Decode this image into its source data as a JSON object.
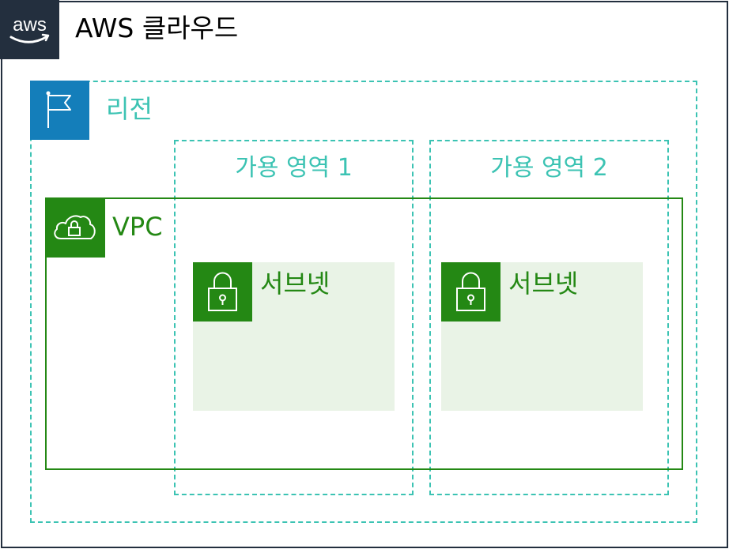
{
  "cloud": {
    "title": "AWS 클라우드",
    "logo_text": "aws"
  },
  "region": {
    "label": "리전",
    "icon": "flag-icon"
  },
  "availability_zones": [
    {
      "label": "가용 영역 1"
    },
    {
      "label": "가용 영역 2"
    }
  ],
  "vpc": {
    "label": "VPC",
    "icon": "cloud-lock-icon"
  },
  "subnets": [
    {
      "label": "서브넷",
      "icon": "padlock-icon"
    },
    {
      "label": "서브넷",
      "icon": "padlock-icon"
    }
  ],
  "colors": {
    "aws_dark": "#232f3e",
    "region_blue": "#147eba",
    "teal": "#3cc3b3",
    "vpc_green": "#248814",
    "subnet_fill": "#e9f3e6"
  }
}
